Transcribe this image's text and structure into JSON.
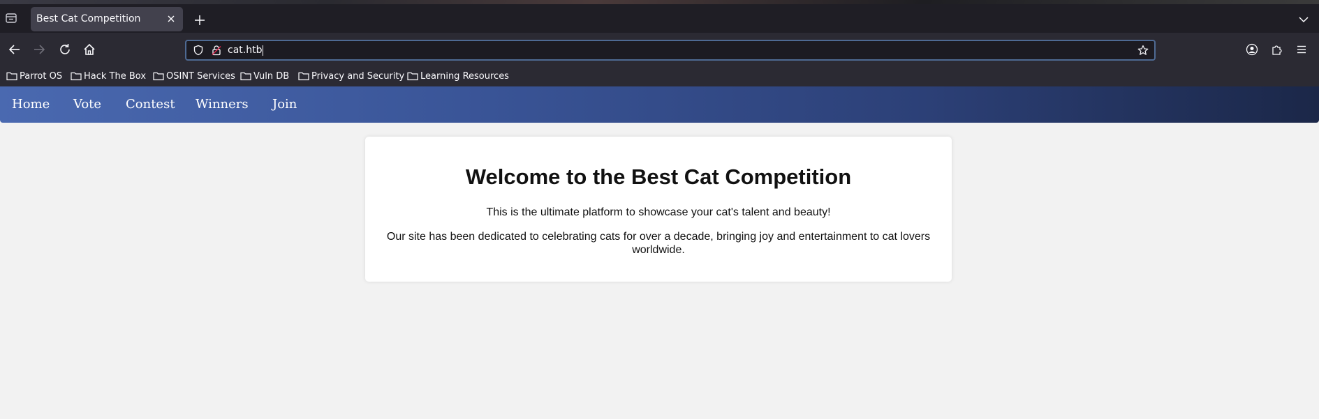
{
  "browser": {
    "tab_title": "Best Cat Competition",
    "url": "cat.htb",
    "bookmarks": [
      {
        "label": "Parrot OS",
        "icon": "folder-icon"
      },
      {
        "label": "Hack The Box",
        "icon": "folder-icon"
      },
      {
        "label": "OSINT Services",
        "icon": "folder-icon"
      },
      {
        "label": "Vuln DB",
        "icon": "folder-icon"
      },
      {
        "label": "Privacy and Security",
        "icon": "folder-icon"
      },
      {
        "label": "Learning Resources",
        "icon": "folder-icon"
      }
    ]
  },
  "site": {
    "nav": [
      {
        "label": "Home"
      },
      {
        "label": "Vote"
      },
      {
        "label": "Contest"
      },
      {
        "label": "Winners"
      },
      {
        "label": "Join"
      }
    ],
    "heading": "Welcome to the Best Cat Competition",
    "intro": "This is the ultimate platform to showcase your cat's talent and beauty!",
    "description": "Our site has been dedicated to celebrating cats for over a decade, bringing joy and entertainment to cat lovers worldwide."
  },
  "colors": {
    "nav_gradient_start": "#4a69b0",
    "nav_gradient_end": "#1b2748",
    "page_background": "#f2f2f2",
    "urlbar_focus": "#4e6a93"
  }
}
